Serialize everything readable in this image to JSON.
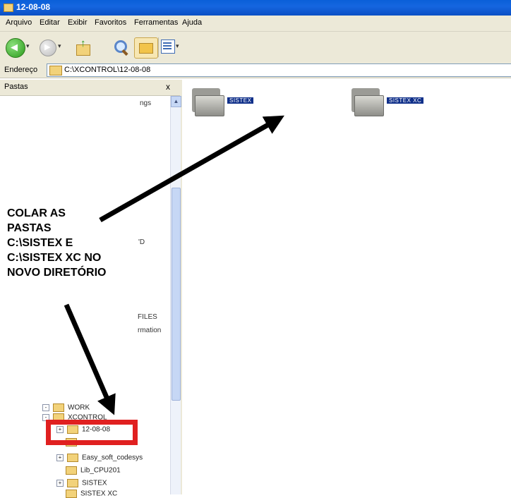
{
  "window": {
    "title": "12-08-08"
  },
  "menu": [
    "Arquivo",
    "Editar",
    "Exibir",
    "Favoritos",
    "Ferramentas",
    "Ajuda"
  ],
  "toolbar": {
    "icons": [
      "back-icon",
      "forward-icon",
      "up-folder-icon",
      "search-icon",
      "folders-icon",
      "views-icon"
    ]
  },
  "address": {
    "label": "Endereço",
    "path": "C:\\XCONTROL\\12-08-08"
  },
  "sidebar": {
    "title": "Pastas",
    "close": "x",
    "fragments": [
      "ngs",
      "'D",
      "FILES",
      "rmation"
    ],
    "tree": [
      {
        "label": "WORK",
        "expander": "-"
      },
      {
        "label": "XCONTROL",
        "expander": "-"
      },
      {
        "label": "12-08-08",
        "expander": "+"
      },
      {
        "label": "",
        "expander": ""
      },
      {
        "label": "Easy_soft_codesys",
        "expander": "+"
      },
      {
        "label": "Lib_CPU201",
        "expander": ""
      },
      {
        "label": "SISTEX",
        "expander": "+"
      },
      {
        "label": "SISTEX XC",
        "expander": ""
      }
    ]
  },
  "content": {
    "items": [
      {
        "label": "SISTEX"
      },
      {
        "label": "SISTEX XC"
      }
    ]
  },
  "annotation": {
    "lines": [
      "COLAR AS",
      "PASTAS",
      "C:\\SISTEX E",
      "C:\\SISTEX XC NO",
      "NOVO DIRETÓRIO"
    ]
  },
  "colors": {
    "title_bar": "#0a5fd8",
    "highlight_box": "#e02020",
    "selection": "#10308a"
  }
}
